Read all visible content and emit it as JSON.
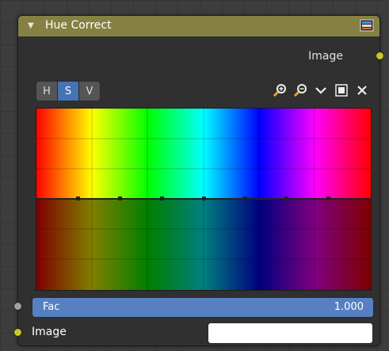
{
  "node": {
    "title": "Hue Correct",
    "output_label": "Image",
    "tabs": [
      {
        "label": "H",
        "active": false
      },
      {
        "label": "S",
        "active": true
      },
      {
        "label": "V",
        "active": false
      }
    ],
    "tools": [
      "zoom-in-icon",
      "zoom-out-icon",
      "chevron-down-icon",
      "clipping-icon",
      "close-icon"
    ],
    "fac_label": "Fac",
    "fac_value": "1.000",
    "input_image_label": "Image",
    "colors": {
      "header": "#858143",
      "socket_image": "#c7c729",
      "socket_fac": "#a1a1a1",
      "fac_bar": "#5680c2",
      "tab_active": "#4772b3"
    }
  }
}
